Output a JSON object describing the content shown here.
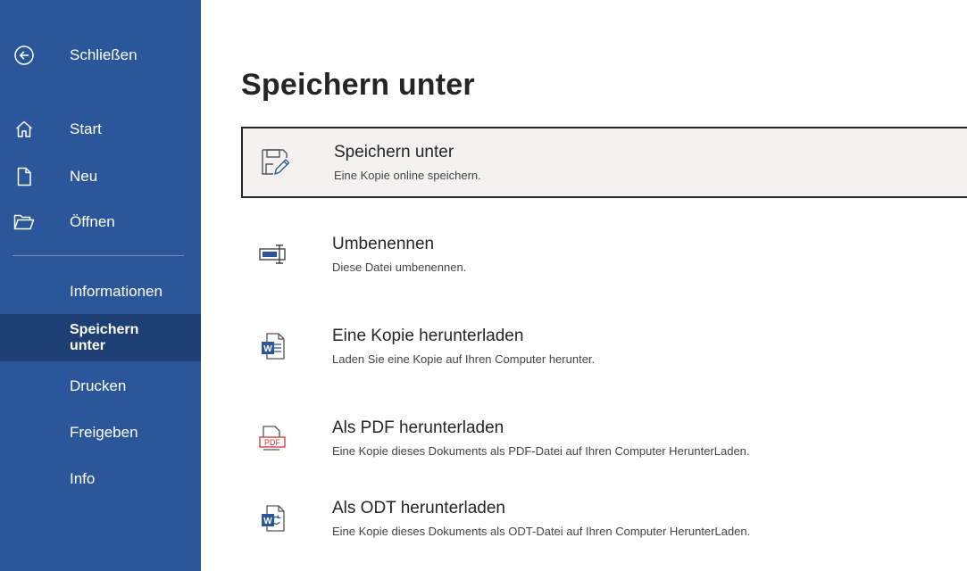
{
  "colors": {
    "sidebar_bg": "#2b579a",
    "sidebar_selected_bg": "#1e3f73",
    "word_blue": "#2b579a",
    "pdf_red": "#d13438"
  },
  "sidebar": {
    "close": {
      "label": "Schließen",
      "icon": "back-arrow-icon"
    },
    "nav_primary": [
      {
        "label": "Start",
        "icon": "home-icon"
      },
      {
        "label": "Neu",
        "icon": "new-document-icon"
      },
      {
        "label": "Öffnen",
        "icon": "folder-open-icon"
      }
    ],
    "nav_secondary": [
      {
        "label": "Informationen"
      },
      {
        "label": "Speichern unter",
        "selected": true
      },
      {
        "label": "Drucken"
      },
      {
        "label": "Freigeben"
      },
      {
        "label": "Info"
      }
    ]
  },
  "main": {
    "title": "Speichern unter",
    "options": [
      {
        "title": "Speichern unter",
        "description": "Eine Kopie online speichern.",
        "icon": "save-as-icon",
        "selected": true
      },
      {
        "title": "Umbenennen",
        "description": "Diese Datei umbenennen.",
        "icon": "rename-icon"
      },
      {
        "title": "Eine Kopie herunterladen",
        "description": "Laden Sie eine Kopie auf Ihren Computer herunter.",
        "icon": "word-document-icon"
      },
      {
        "title": "Als PDF herunterladen",
        "description": "Eine Kopie dieses Dokuments als PDF-Datei auf Ihren Computer HerunterLaden.",
        "icon": "pdf-document-icon"
      },
      {
        "title": "Als ODT herunterladen",
        "description": "Eine Kopie dieses Dokuments als ODT-Datei auf Ihren Computer HerunterLaden.",
        "icon": "odt-document-icon"
      }
    ]
  }
}
